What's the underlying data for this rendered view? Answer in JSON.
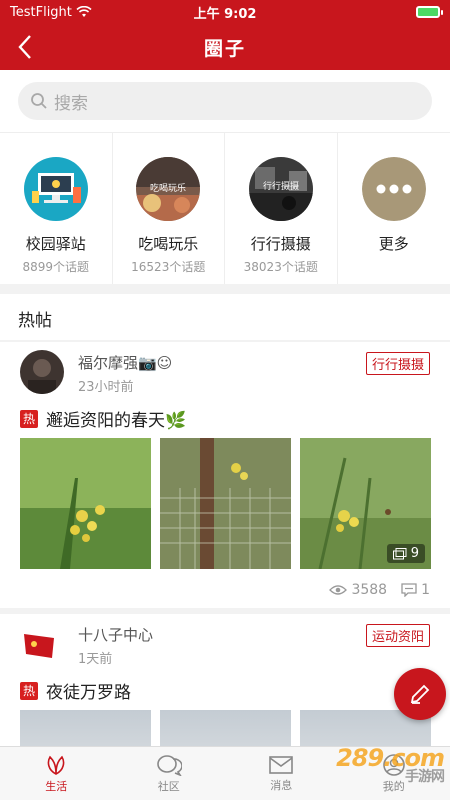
{
  "status": {
    "carrier": "TestFlight",
    "time": "上午 9:02"
  },
  "nav": {
    "title": "圈子"
  },
  "search": {
    "placeholder": "搜索"
  },
  "circles": [
    {
      "name": "校园驿站",
      "count": "8899个话题"
    },
    {
      "name": "吃喝玩乐",
      "count": "16523个话题",
      "thumb_text": "吃喝玩乐"
    },
    {
      "name": "行行摄摄",
      "count": "38023个话题",
      "thumb_text": "行行摄摄"
    },
    {
      "name": "更多",
      "count": ""
    }
  ],
  "hot": {
    "heading": "热帖"
  },
  "posts": [
    {
      "author": "福尔摩强📷☺",
      "time": "23小时前",
      "tag": "行行摄摄",
      "badge": "热",
      "title": "邂逅资阳的春天🌿",
      "image_count": "9",
      "views": "3588",
      "comments": "1"
    },
    {
      "author": "十八子中心",
      "time": "1天前",
      "tag": "运动资阳",
      "badge": "热",
      "title": "夜徒万罗路"
    }
  ],
  "tabs": [
    {
      "label": "生活",
      "icon": "leaf-icon",
      "active": true
    },
    {
      "label": "社区",
      "icon": "chat-icon",
      "active": false
    },
    {
      "label": "消息",
      "icon": "mail-icon",
      "active": false
    },
    {
      "label": "我的",
      "icon": "user-icon",
      "active": false
    }
  ],
  "watermark": {
    "main": "289.com",
    "sub": "手游网"
  },
  "colors": {
    "brand": "#c8161d"
  }
}
